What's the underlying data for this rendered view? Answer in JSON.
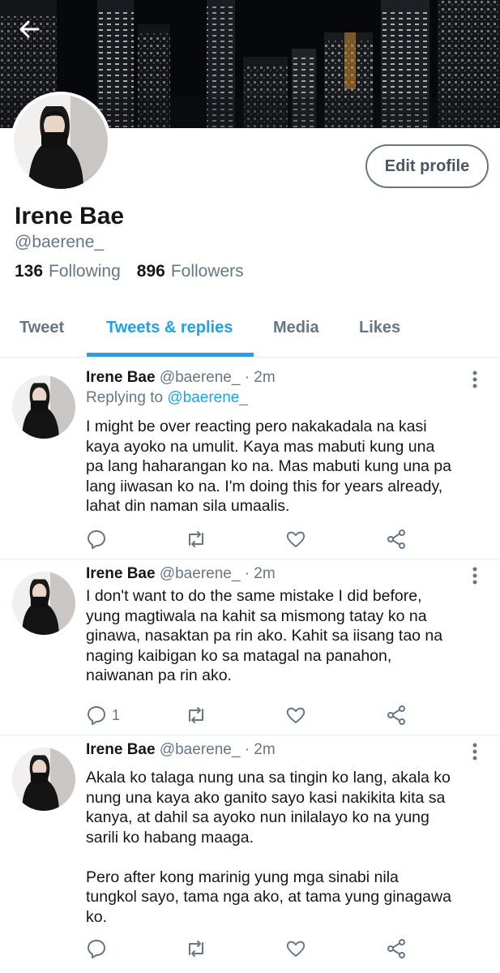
{
  "profile": {
    "name": "Irene Bae",
    "handle": "@baerene_",
    "following_count": "136",
    "following_label": "Following",
    "followers_count": "896",
    "followers_label": "Followers",
    "edit_button": "Edit profile"
  },
  "tabs": [
    {
      "label": "Tweet",
      "active": false
    },
    {
      "label": "Tweets & replies",
      "active": true
    },
    {
      "label": "Media",
      "active": false
    },
    {
      "label": "Likes",
      "active": false
    }
  ],
  "tweets": [
    {
      "name": "Irene Bae",
      "meta": "@baerene_ · 2m",
      "replying_prefix": "Replying to",
      "replying_mention": "@baerene_",
      "text": "I might be over reacting pero nakakadala na kasi\nkaya ayoko na umulit. Kaya mas mabuti kung una\npa lang haharangan ko na. Mas mabuti kung una pa\nlang iiwasan ko na. I'm doing this for years already,\nlahat din naman sila umaalis.",
      "reply_count": ""
    },
    {
      "name": "Irene Bae",
      "meta": "@baerene_ · 2m",
      "text": "I don't want to do the same mistake I did before,\nyung magtiwala na kahit sa mismong tatay ko na\nginawa, nasaktan pa rin ako. Kahit sa iisang tao na\nnaging kaibigan ko sa matagal na panahon,\nnaiwanan pa rin ako.",
      "reply_count": "1"
    },
    {
      "name": "Irene Bae",
      "meta": "@baerene_ · 2m",
      "text": "Akala ko talaga nung una sa tingin ko lang, akala ko\nnung una kaya ako ganito sayo kasi nakikita kita sa\nkanya, at dahil sa ayoko nun inilalayo ko na yung\nsarili ko habang maaga.\n\nPero after kong marinig yung mga sinabi nila\ntungkol sayo, tama nga ako, at tama yung ginagawa\nko.",
      "reply_count": ""
    }
  ],
  "icons": {
    "back": "arrow-left-icon",
    "more": "more-vertical-icon",
    "reply": "comment-icon",
    "retweet": "retweet-icon",
    "like": "heart-icon",
    "share": "share-icon"
  },
  "colors": {
    "accent": "#1da1f2",
    "secondary_text": "#657786",
    "primary_text": "#14171a"
  }
}
